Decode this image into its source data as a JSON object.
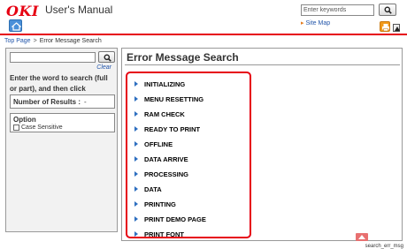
{
  "header": {
    "logo": "OKI",
    "title": "User's Manual",
    "search_placeholder": "Enter keywords",
    "sitemap_label": "Site Map"
  },
  "breadcrumb": {
    "top": "Top Page",
    "sep": ">",
    "current": "Error Message Search"
  },
  "sidebar": {
    "search_value": "",
    "clear_label": "Clear",
    "instruction": "Enter the word to search (full or part), and then click [Search].",
    "results_label": "Number of Results :",
    "results_value": "-",
    "option_title": "Option",
    "case_label": "Case Sensitive"
  },
  "main": {
    "title": "Error Message Search",
    "items": [
      "INITIALIZING",
      "MENU RESETTING",
      "RAM CHECK",
      "READY TO PRINT",
      "OFFLINE",
      "DATA ARRIVE",
      "PROCESSING",
      "DATA",
      "PRINTING",
      "PRINT DEMO PAGE",
      "PRINT FONT"
    ]
  },
  "footer": {
    "page_id": "search_err_msg"
  },
  "colors": {
    "brand_red": "#e60012",
    "link_blue": "#2255aa",
    "arrow_blue": "#2e6fc0",
    "print_orange": "#f29a1a"
  }
}
